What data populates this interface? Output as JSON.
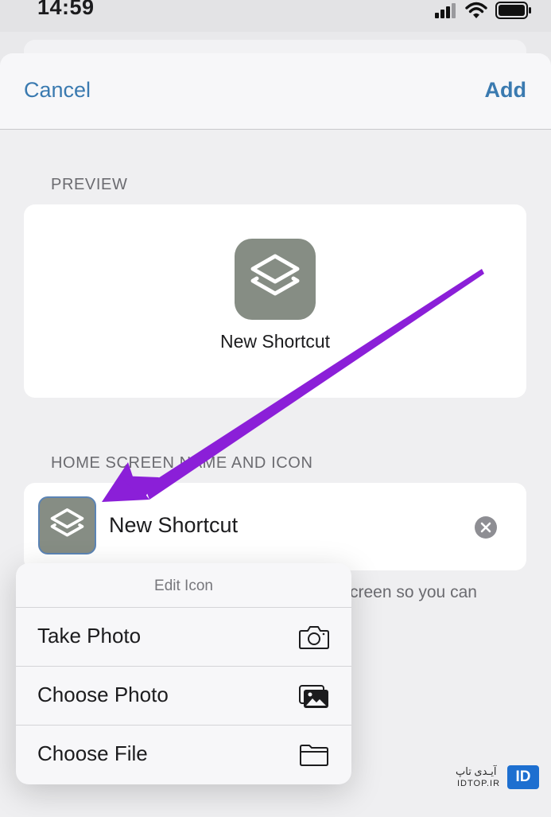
{
  "status_bar": {
    "time": "14:59"
  },
  "nav": {
    "cancel_label": "Cancel",
    "add_label": "Add"
  },
  "preview": {
    "section_label": "PREVIEW",
    "shortcut_name": "New Shortcut"
  },
  "home_screen": {
    "section_label": "HOME SCREEN NAME AND ICON",
    "name_value": "New Shortcut",
    "caption_fragment": "creen so you can"
  },
  "edit_icon_menu": {
    "title": "Edit Icon",
    "items": [
      {
        "label": "Take Photo",
        "icon": "camera-icon"
      },
      {
        "label": "Choose Photo",
        "icon": "photos-icon"
      },
      {
        "label": "Choose File",
        "icon": "folder-icon"
      }
    ]
  },
  "watermark": {
    "badge": "ID",
    "text_fa": "آیـدی تاپ",
    "text_en": "IDTOP.IR"
  },
  "colors": {
    "accent": "#3a7ab0",
    "tile": "#868d84",
    "annotation_arrow": "#8b1fd8",
    "watermark": "#1d6fd0"
  }
}
